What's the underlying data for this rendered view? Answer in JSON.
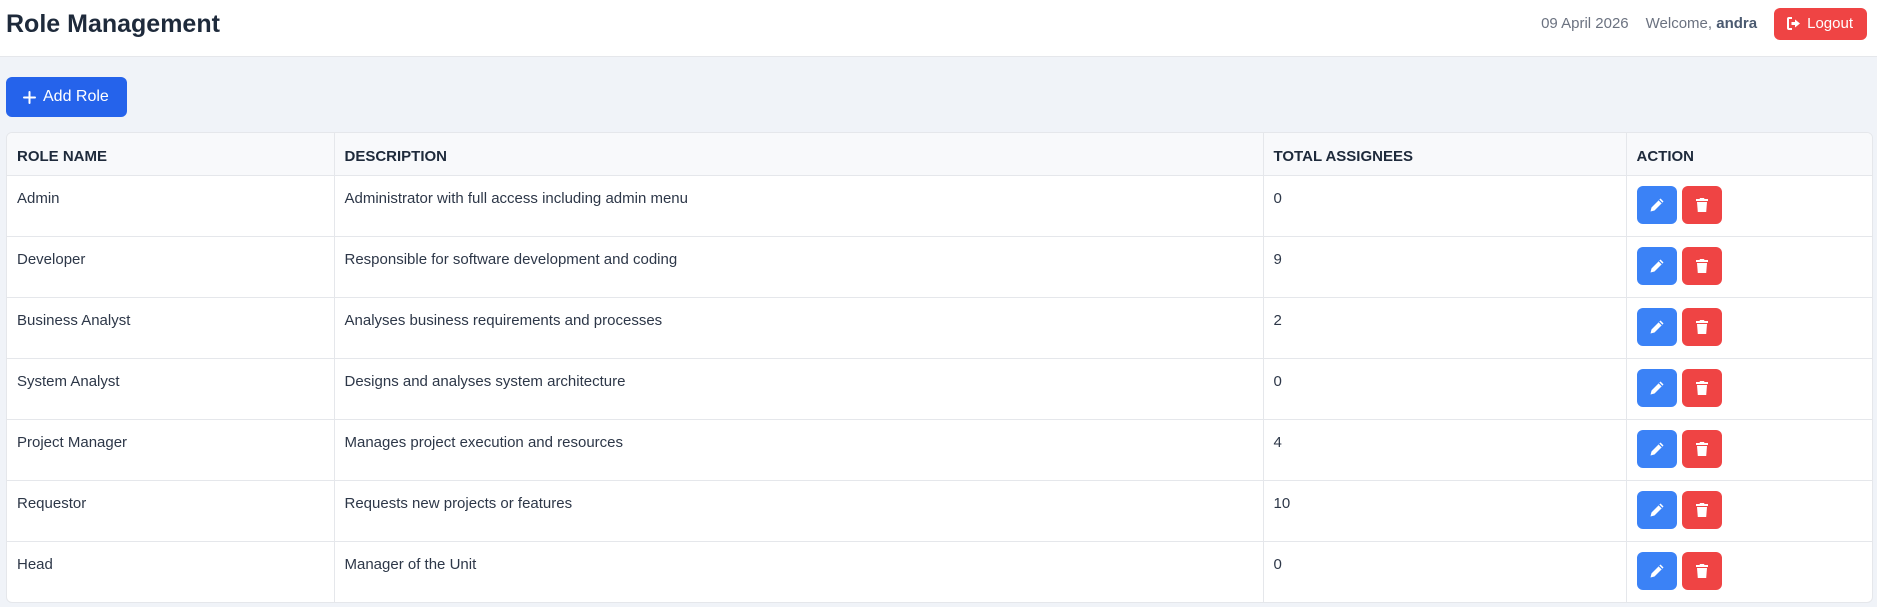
{
  "header": {
    "title": "Role Management",
    "date": "09 April 2026",
    "welcome_label": "Welcome,",
    "username": "andra",
    "logout_label": "Logout"
  },
  "toolbar": {
    "add_role_label": "Add Role"
  },
  "table": {
    "columns": [
      "ROLE NAME",
      "DESCRIPTION",
      "TOTAL ASSIGNEES",
      "ACTION"
    ],
    "rows": [
      {
        "name": "Admin",
        "description": "Administrator with full access including admin menu",
        "assignees": "0"
      },
      {
        "name": "Developer",
        "description": "Responsible for software development and coding",
        "assignees": "9"
      },
      {
        "name": "Business Analyst",
        "description": "Analyses business requirements and processes",
        "assignees": "2"
      },
      {
        "name": "System Analyst",
        "description": "Designs and analyses system architecture",
        "assignees": "0"
      },
      {
        "name": "Project Manager",
        "description": "Manages project execution and resources",
        "assignees": "4"
      },
      {
        "name": "Requestor",
        "description": "Requests new projects or features",
        "assignees": "10"
      },
      {
        "name": "Head",
        "description": "Manager of the Unit",
        "assignees": "0"
      }
    ]
  },
  "icons": {
    "logout": "sign-out-icon",
    "add": "plus-icon",
    "edit": "pencil-icon",
    "delete": "trash-icon"
  },
  "colors": {
    "primary": "#2563eb",
    "edit": "#3b82f6",
    "danger": "#ef4444",
    "background": "#f0f3f8"
  }
}
